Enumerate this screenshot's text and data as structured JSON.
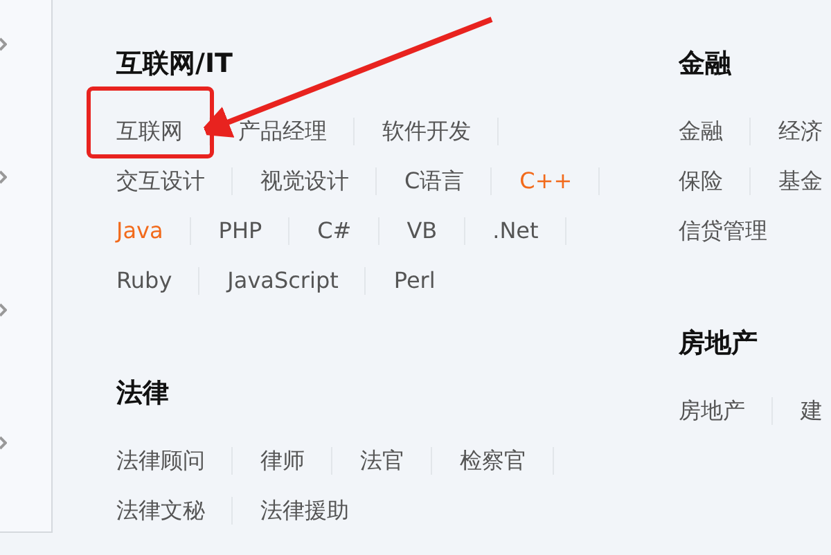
{
  "columns": [
    {
      "sections": [
        {
          "title": "互联网/IT",
          "items": [
            {
              "label": "互联网",
              "highlighted": false
            },
            {
              "label": "产品经理",
              "highlighted": false
            },
            {
              "label": "软件开发",
              "highlighted": false
            },
            {
              "label": "交互设计",
              "highlighted": false
            },
            {
              "label": "视觉设计",
              "highlighted": false
            },
            {
              "label": "C语言",
              "highlighted": false
            },
            {
              "label": "C++",
              "highlighted": true
            },
            {
              "label": "Java",
              "highlighted": true
            },
            {
              "label": "PHP",
              "highlighted": false
            },
            {
              "label": "C#",
              "highlighted": false
            },
            {
              "label": "VB",
              "highlighted": false
            },
            {
              "label": ".Net",
              "highlighted": false
            },
            {
              "label": "Ruby",
              "highlighted": false
            },
            {
              "label": "JavaScript",
              "highlighted": false
            },
            {
              "label": "Perl",
              "highlighted": false
            }
          ]
        },
        {
          "title": "法律",
          "items": [
            {
              "label": "法律顾问",
              "highlighted": false
            },
            {
              "label": "律师",
              "highlighted": false
            },
            {
              "label": "法官",
              "highlighted": false
            },
            {
              "label": "检察官",
              "highlighted": false
            },
            {
              "label": "法律文秘",
              "highlighted": false
            },
            {
              "label": "法律援助",
              "highlighted": false
            }
          ]
        }
      ]
    },
    {
      "sections": [
        {
          "title": "金融",
          "items": [
            {
              "label": "金融",
              "highlighted": false
            },
            {
              "label": "经济",
              "highlighted": false
            },
            {
              "label": "保险",
              "highlighted": false
            },
            {
              "label": "基金",
              "highlighted": false
            },
            {
              "label": "信贷管理",
              "highlighted": false
            }
          ]
        },
        {
          "title": "房地产",
          "items": [
            {
              "label": "房地产",
              "highlighted": false
            },
            {
              "label": "建",
              "highlighted": false
            }
          ]
        }
      ]
    }
  ]
}
